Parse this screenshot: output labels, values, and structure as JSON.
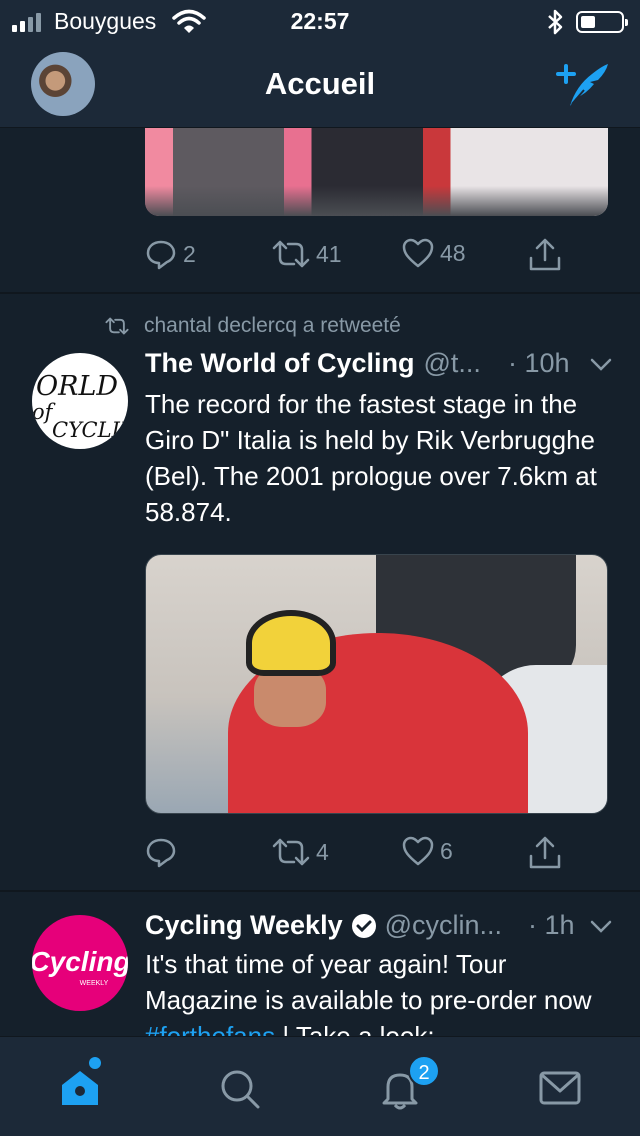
{
  "status_bar": {
    "carrier": "Bouygues",
    "time": "22:57"
  },
  "header": {
    "title": "Accueil"
  },
  "tweets": [
    {
      "actions": {
        "replies": "2",
        "retweets": "41",
        "likes": "48"
      }
    },
    {
      "retweet_context": "chantal declercq a retweeté",
      "display_name": "The World of Cycling",
      "handle": "@t...",
      "time": "· 10h",
      "text": "The record for the fastest stage in the Giro D\" Italia is held by Rik Verbrugghe (Bel). The 2001 prologue over 7.6km at 58.874.",
      "avatar_text": "ORLD of CYCLIN",
      "actions": {
        "replies": "",
        "retweets": "4",
        "likes": "6"
      }
    },
    {
      "display_name": "Cycling Weekly",
      "handle": "@cyclin...",
      "time": "· 1h",
      "text_before_link": "It's that time of year again! Tour Magazine is available to pre-order now ",
      "hashtag": "#forthefans",
      "text_after_link": " | Take a look:",
      "avatar_text": "Cycling",
      "avatar_subtext": "WEEKLY"
    }
  ],
  "tab_bar": {
    "notifications_badge": "2",
    "icons": [
      "home-icon",
      "search-icon",
      "bell-icon",
      "mail-icon"
    ]
  },
  "colors": {
    "background": "#15202b",
    "bar": "#1c2938",
    "accent": "#1da1f2",
    "muted": "#8899a6"
  }
}
